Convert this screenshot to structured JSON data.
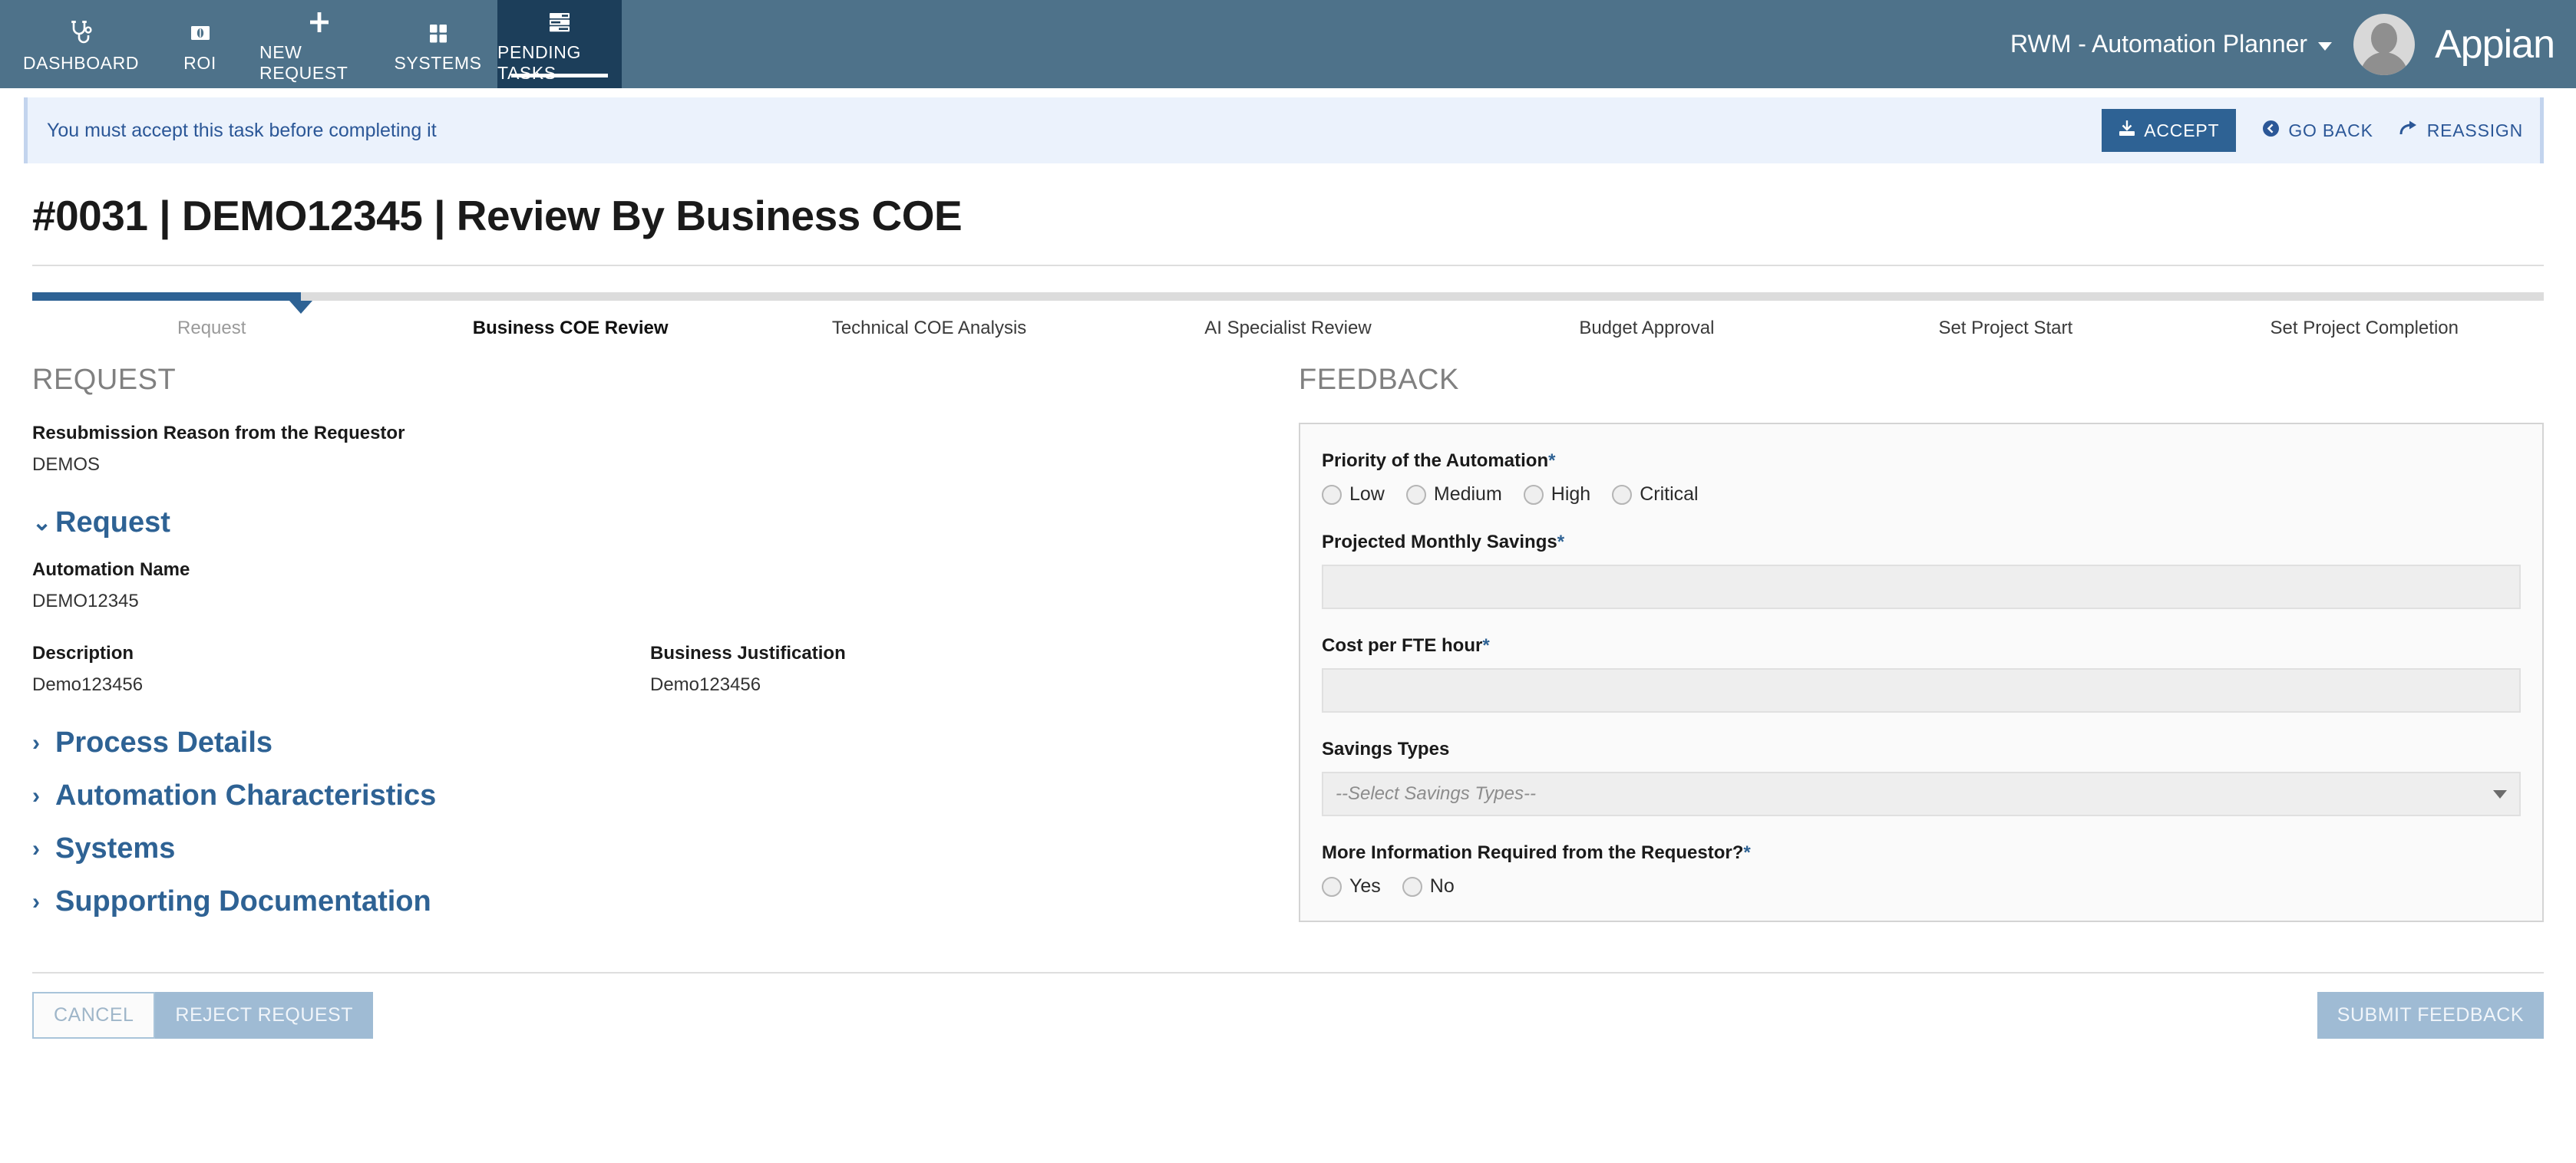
{
  "topnav": {
    "items": [
      {
        "label": "DASHBOARD",
        "icon": "stethoscope-icon",
        "active": false
      },
      {
        "label": "ROI",
        "icon": "money-bill-icon",
        "active": false
      },
      {
        "label": "NEW REQUEST",
        "icon": "plus-icon",
        "active": false
      },
      {
        "label": "SYSTEMS",
        "icon": "grid-squares-icon",
        "active": false
      },
      {
        "label": "PENDING TASKS",
        "icon": "task-list-icon",
        "active": true
      }
    ],
    "user_menu_label": "RWM - Automation Planner",
    "brand": "Appian",
    "colors": {
      "bar": "#4e728a",
      "active_tab": "#1c3e5a"
    }
  },
  "banner": {
    "message": "You must accept this task before completing it",
    "accept_label": "ACCEPT",
    "go_back_label": "GO BACK",
    "reassign_label": "REASSIGN",
    "accent": "#2e6294",
    "background": "#ebf2fc"
  },
  "page": {
    "title": "#0031 | DEMO12345 | Review By Business COE"
  },
  "stepper": {
    "fill_percent": 10.7,
    "steps": [
      {
        "label": "Request",
        "state": "done"
      },
      {
        "label": "Business COE Review",
        "state": "current"
      },
      {
        "label": "Technical COE Analysis",
        "state": "upcoming"
      },
      {
        "label": "AI Specialist Review",
        "state": "upcoming"
      },
      {
        "label": "Budget Approval",
        "state": "upcoming"
      },
      {
        "label": "Set Project Start",
        "state": "upcoming"
      },
      {
        "label": "Set Project Completion",
        "state": "upcoming"
      }
    ]
  },
  "request": {
    "heading": "REQUEST",
    "resubmission_label": "Resubmission Reason from the Requestor",
    "resubmission_value": "DEMOS",
    "request_accordion": {
      "label": "Request",
      "chevron": "expanded"
    },
    "automation_name_label": "Automation Name",
    "automation_name_value": "DEMO12345",
    "description_label": "Description",
    "description_value": "Demo123456",
    "business_justification_label": "Business Justification",
    "business_justification_value": "Demo123456",
    "collapsed_sections": [
      {
        "label": "Process Details",
        "chevron": "collapsed"
      },
      {
        "label": "Automation Characteristics",
        "chevron": "collapsed"
      },
      {
        "label": "Systems",
        "chevron": "collapsed"
      },
      {
        "label": "Supporting Documentation",
        "chevron": "collapsed"
      }
    ]
  },
  "feedback": {
    "heading": "FEEDBACK",
    "priority": {
      "label": "Priority of the Automation",
      "required": "*",
      "options": [
        "Low",
        "Medium",
        "High",
        "Critical"
      ],
      "selected": null
    },
    "projected_monthly_savings": {
      "label": "Projected Monthly Savings",
      "required": "*",
      "value": ""
    },
    "cost_per_fte_hour": {
      "label": "Cost per FTE hour",
      "required": "*",
      "value": ""
    },
    "savings_types": {
      "label": "Savings Types",
      "required": "",
      "placeholder": "--Select Savings Types--",
      "value": ""
    },
    "more_info_required": {
      "label": "More Information Required from the Requestor?",
      "required": "*",
      "options": [
        "Yes",
        "No"
      ],
      "selected": null
    }
  },
  "footer": {
    "cancel_label": "CANCEL",
    "reject_label": "REJECT REQUEST",
    "submit_label": "SUBMIT FEEDBACK"
  }
}
